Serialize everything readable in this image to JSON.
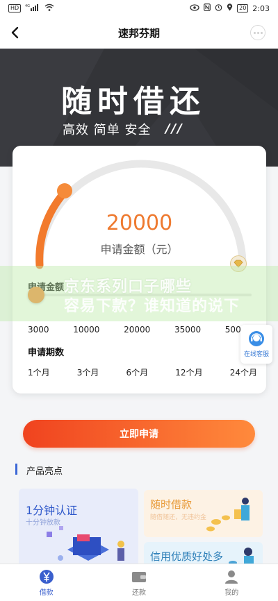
{
  "status_bar": {
    "network": "HD",
    "signal": "4G",
    "battery": "20",
    "time": "2:03"
  },
  "nav": {
    "title": "速邦芬期"
  },
  "banner": {
    "title": "随时借还",
    "subtitle": "高效 简单 安全",
    "slashes": "///"
  },
  "loan": {
    "amount": "20000",
    "amount_label": "申请金额（元）",
    "amount_section_label": "申请金额",
    "slider_fraction": 0.04,
    "amount_ticks": [
      "3000",
      "10000",
      "20000",
      "35000",
      "50000"
    ],
    "period_section_label": "申请期数",
    "periods": [
      "1个月",
      "3个月",
      "6个月",
      "12个月",
      "24个月"
    ]
  },
  "watermark": {
    "line1": "京东系列口子哪些",
    "line2": "容易下款？谁知道的说下"
  },
  "service": {
    "label": "在线客服"
  },
  "apply_button": {
    "label": "立即申请"
  },
  "highlights": {
    "title": "产品亮点",
    "tiles": [
      {
        "title": "1分钟认证",
        "subtitle": "十分钟放款"
      },
      {
        "title": "随时借款",
        "subtitle": "随借随还，无违约金"
      },
      {
        "title": "信用优质好处多"
      }
    ]
  },
  "tabs": [
    {
      "label": "借款",
      "icon": "yen-icon",
      "active": true
    },
    {
      "label": "还款",
      "icon": "wallet-icon",
      "active": false
    },
    {
      "label": "我的",
      "icon": "user-icon",
      "active": false
    }
  ],
  "colors": {
    "accent": "#f27a2c",
    "banner_bg": "#333438",
    "tab_active": "#3a5fcd"
  }
}
